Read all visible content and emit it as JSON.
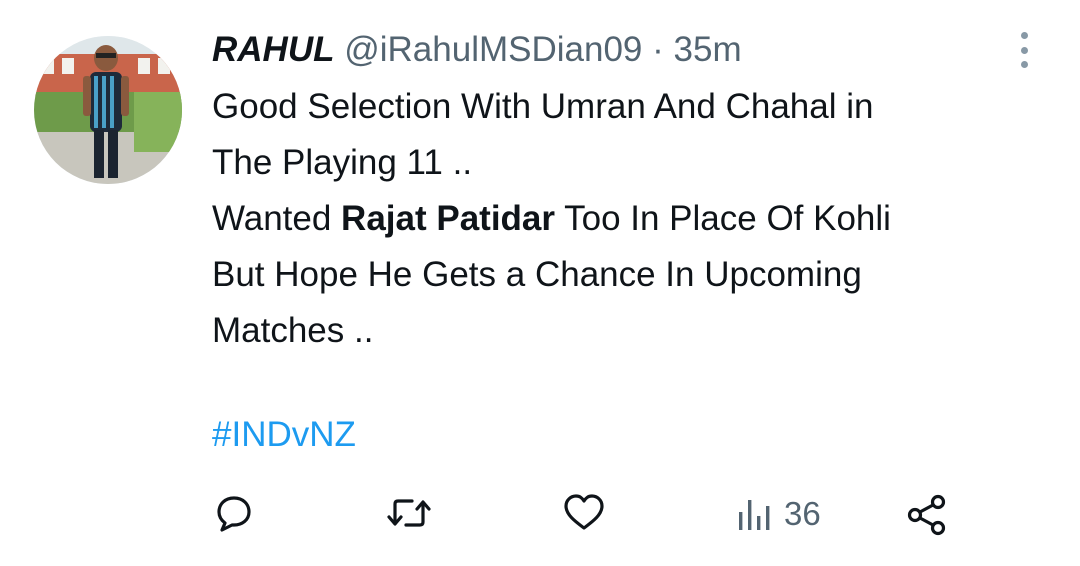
{
  "author": {
    "name": "RAHUL",
    "handle": "@iRahulMSDian09",
    "separator": "·",
    "time": "35m"
  },
  "tweet": {
    "line1": "Good Selection With Umran And Chahal in",
    "line2": "The Playing 11 ..",
    "line3_pre": "Wanted ",
    "line3_bold": "Rajat Patidar",
    "line3_post": " Too In Place Of Kohli",
    "line4": "But Hope He Gets a Chance In Upcoming",
    "line5": "Matches ..",
    "hashtag": "#INDvNZ"
  },
  "actions": {
    "views_count": "36"
  },
  "icons": {
    "reply": "reply-icon",
    "retweet": "retweet-icon",
    "like": "heart-icon",
    "views": "analytics-icon",
    "share": "share-icon",
    "more": "more-vertical-icon"
  },
  "colors": {
    "text": "#0f1419",
    "secondary": "#536471",
    "link": "#1d9bf0"
  }
}
